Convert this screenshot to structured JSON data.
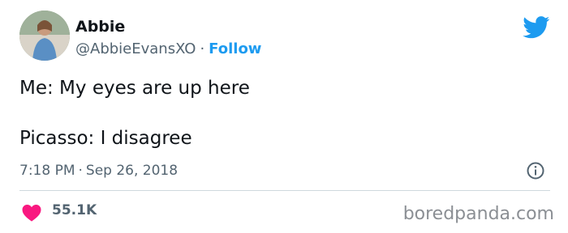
{
  "tweet": {
    "author_name": "Abbie",
    "handle": "@AbbieEvansXO",
    "separator": "·",
    "follow_label": "Follow",
    "lines": [
      "Me: My eyes are up here",
      "Picasso: I disagree"
    ],
    "time": "7:18 PM",
    "date": "Sep 26, 2018",
    "likes": "55.1K"
  },
  "icons": {
    "brand": "twitter-bird-icon",
    "info": "info-icon",
    "like": "heart-icon"
  },
  "colors": {
    "accent": "#1d9bf0",
    "heart": "#f91880",
    "secondary_text": "#536471"
  },
  "watermark": "boredpanda.com"
}
